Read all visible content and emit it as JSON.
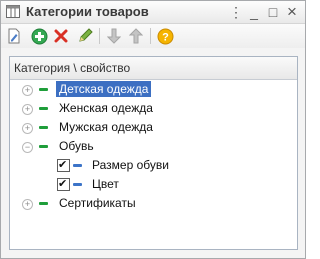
{
  "window": {
    "title": "Категории товаров",
    "controls": {
      "more": "⋮",
      "minimize": "_",
      "maximize": "□",
      "close": "×"
    }
  },
  "toolbar": {
    "buttons": [
      "edit-icon",
      "add-icon",
      "delete-icon",
      "pencil-icon",
      "move-down-icon",
      "move-up-icon",
      "help-icon"
    ]
  },
  "tree": {
    "header": "Категория \\ свойство",
    "items": [
      {
        "label": "Детская одежда",
        "expander": "+",
        "selected": true
      },
      {
        "label": "Женская одежда",
        "expander": "+"
      },
      {
        "label": "Мужская одежда",
        "expander": "+"
      },
      {
        "label": "Обувь",
        "expander": "−"
      },
      {
        "label": "Размер обуви",
        "checked": true,
        "check": "✔"
      },
      {
        "label": "Цвет",
        "checked": true,
        "check": "✔"
      },
      {
        "label": "Сертификаты",
        "expander": "+"
      }
    ]
  },
  "colors": {
    "category": "#1f9e3a",
    "property": "#3c74c8",
    "selection": "#3c6fc2"
  }
}
